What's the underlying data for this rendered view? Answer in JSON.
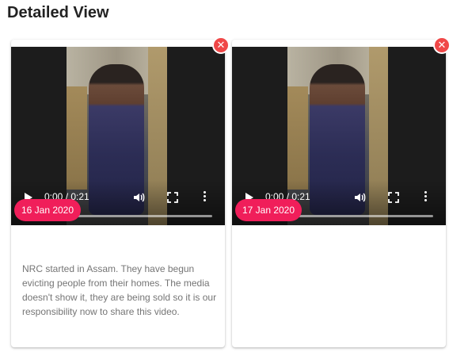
{
  "page": {
    "title": "Detailed View"
  },
  "cards": [
    {
      "video": {
        "time": "0:00 / 0:21",
        "progress": 0
      },
      "date": "16 Jan 2020",
      "description": "NRC started in Assam. They have begun evicting people from their homes. The media doesn't show it, they are being sold so it is our responsibility now to share this video.",
      "close_icon": "close-icon"
    },
    {
      "video": {
        "time": "0:00 / 0:21",
        "progress": 0
      },
      "date": "17 Jan 2020",
      "description": "",
      "close_icon": "close-icon"
    }
  ],
  "colors": {
    "badge": "#f01e5a",
    "close": "#f04848",
    "text_muted": "#757575"
  }
}
